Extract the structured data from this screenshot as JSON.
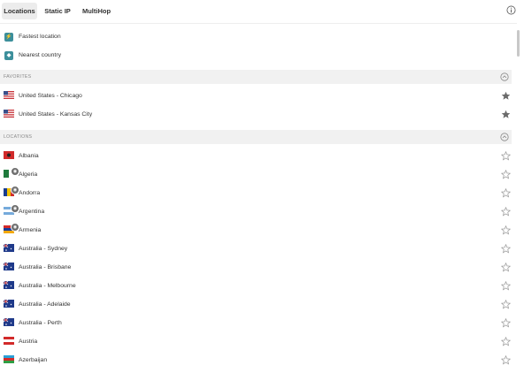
{
  "tabs": [
    {
      "label": "Locations"
    },
    {
      "label": "Static IP"
    },
    {
      "label": "MultiHop"
    }
  ],
  "quick_connect": [
    {
      "label": "Fastest location",
      "icon": "lightning-icon"
    },
    {
      "label": "Nearest country",
      "icon": "location-pin-icon"
    }
  ],
  "favorites": {
    "title": "FAVORITES",
    "items": [
      {
        "label": "United States - Chicago",
        "favorite": true
      },
      {
        "label": "United States - Kansas City",
        "favorite": true
      }
    ]
  },
  "locations": {
    "title": "LOCATIONS",
    "items": [
      {
        "label": "Albania",
        "favorite": false
      },
      {
        "label": "Algeria",
        "favorite": false,
        "virtual": true
      },
      {
        "label": "Andorra",
        "favorite": false,
        "virtual": true
      },
      {
        "label": "Argentina",
        "favorite": false,
        "virtual": true
      },
      {
        "label": "Armenia",
        "favorite": false,
        "virtual": true
      },
      {
        "label": "Australia - Sydney",
        "favorite": false
      },
      {
        "label": "Australia - Brisbane",
        "favorite": false
      },
      {
        "label": "Australia - Melbourne",
        "favorite": false
      },
      {
        "label": "Australia - Adelaide",
        "favorite": false
      },
      {
        "label": "Australia - Perth",
        "favorite": false
      },
      {
        "label": "Austria",
        "favorite": false
      },
      {
        "label": "Azerbaijan",
        "favorite": false
      }
    ]
  },
  "colors": {
    "accent": "#3c8f9b",
    "section_bg": "#f1f1f1",
    "active_tab_bg": "#ececec",
    "star_filled": "#6b6b6b",
    "star_outline": "#9a9a9a"
  }
}
